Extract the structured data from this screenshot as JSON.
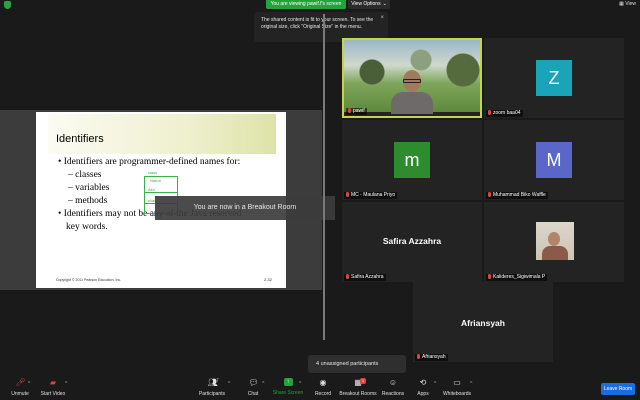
{
  "top": {
    "viewing_label": "You are viewing pawif.f's screen",
    "view_options_label": "View Options",
    "view_right_label": "View",
    "tooltip_text": "The shared content is fit to your screen. To see the original size, click \"Original Size\" in the menu."
  },
  "slide": {
    "title": "Identifiers",
    "bullet1": "• Identifiers are programmer-defined names for:",
    "sub_items": [
      "– classes",
      "– variables",
      "– methods"
    ],
    "bullet2_line1": "• Identifiers may not be any of the Java reserved",
    "bullet2_line2": "key words.",
    "footer_left": "Copyright © 2011 Pearson Education, Inc.",
    "footer_right": "2-32",
    "annotations": [
      "class",
      "Nama",
      "Alm",
      "nilai"
    ]
  },
  "overlay": {
    "breakout_text": "You are now in a Breakout Room"
  },
  "participants": [
    {
      "name": "pawif",
      "type": "video",
      "active": true
    },
    {
      "name": "zoom baa04",
      "initial": "Z",
      "color": "#1aa4b8"
    },
    {
      "name": "MC - Maulana Priyo",
      "initial": "m",
      "color": "#2e8b2e"
    },
    {
      "name": "Muhammad Biko Waffle",
      "initial": "M",
      "color": "#5a67c8"
    },
    {
      "name": "Safira Azzahra",
      "big": "Safira Azzahra"
    },
    {
      "name": "Kalideres_Sigiwimala P",
      "type": "video-small"
    },
    {
      "name": "Afriansyah",
      "big": "Afriansyah"
    }
  ],
  "unassigned": "4 unassigned participants",
  "toolbar": {
    "unmute": "Unmute",
    "start_video": "Start Video",
    "participants": "Participants",
    "participants_count": "7",
    "chat": "Chat",
    "share_screen": "Share Screen",
    "record": "Record",
    "breakout_rooms": "Breakout Rooms",
    "reactions": "Reactions",
    "apps": "Apps",
    "whiteboards": "Whiteboards",
    "leave": "Leave Room"
  },
  "colors": {
    "share_green": "#23a33b",
    "leave_blue": "#1a6de0",
    "active_speaker_border": "#c8d34a"
  }
}
